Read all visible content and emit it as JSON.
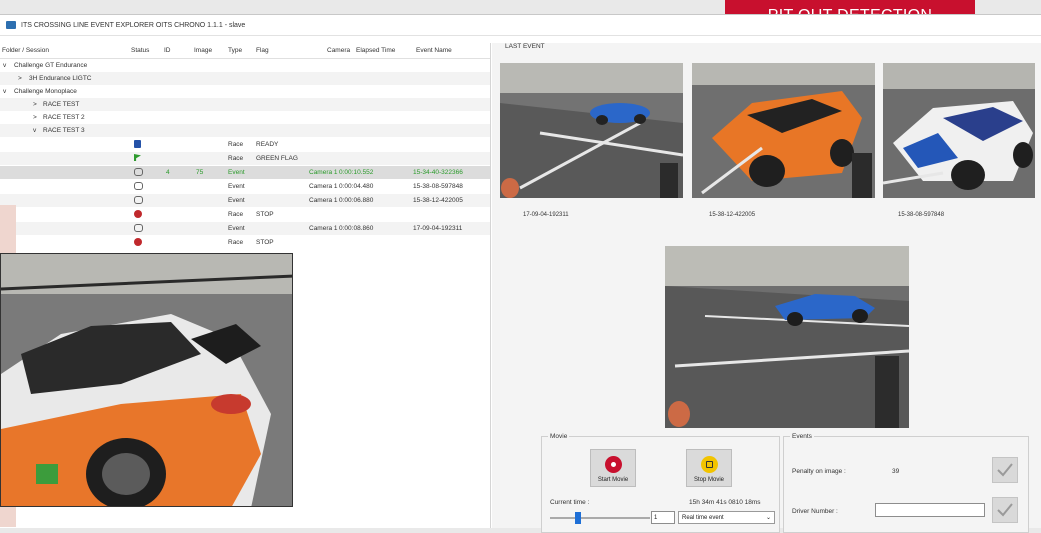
{
  "header": {
    "badge": "PIT OUT DETECTION"
  },
  "window": {
    "title": "ITS CROSSING LINE EVENT EXPLORER OITS CHRONO 1.1.1 - slave"
  },
  "table": {
    "columns": [
      "Folder / Session",
      "Status",
      "ID",
      "Image",
      "Type",
      "Flag",
      "Camera",
      "Elapsed Time",
      "Event Name"
    ],
    "tree": [
      {
        "indent": 0,
        "arrow": "v",
        "label": "Challenge GT Endurance"
      },
      {
        "indent": 1,
        "arrow": ">",
        "label": "3H Endurance LIGTC"
      },
      {
        "indent": 0,
        "arrow": "v",
        "label": "Challenge Monoplace"
      },
      {
        "indent": 1,
        "arrow": ">",
        "label": "RACE TEST"
      },
      {
        "indent": 1,
        "arrow": ">",
        "label": "RACE TEST 2"
      },
      {
        "indent": 1,
        "arrow": "v",
        "label": "RACE TEST 3"
      }
    ],
    "events": [
      {
        "icon": "blue-flag",
        "id": "",
        "image": "",
        "type": "Race",
        "flag": "READY",
        "camera": "",
        "elapsed": "",
        "event": ""
      },
      {
        "icon": "green-flag",
        "id": "",
        "image": "",
        "type": "Race",
        "flag": "GREEN FLAG",
        "camera": "",
        "elapsed": "",
        "event": ""
      },
      {
        "icon": "camera",
        "id": "4",
        "image": "75",
        "type": "Event",
        "flag": "",
        "camera": "Camera 1",
        "elapsed": "0:00:10.552",
        "event": "15-34-40-322366"
      },
      {
        "icon": "camera",
        "id": "",
        "image": "",
        "type": "Event",
        "flag": "",
        "camera": "Camera 1",
        "elapsed": "0:00:04.480",
        "event": "15-38-08-597848"
      },
      {
        "icon": "camera",
        "id": "",
        "image": "",
        "type": "Event",
        "flag": "",
        "camera": "Camera 1",
        "elapsed": "0:00:06.880",
        "event": "15-38-12-422005"
      },
      {
        "icon": "stop",
        "id": "",
        "image": "",
        "type": "Race",
        "flag": "STOP",
        "camera": "",
        "elapsed": "",
        "event": ""
      },
      {
        "icon": "camera",
        "id": "",
        "image": "",
        "type": "Event",
        "flag": "",
        "camera": "Camera 1",
        "elapsed": "0:00:08.860",
        "event": "17-09-04-192311"
      },
      {
        "icon": "stop",
        "id": "",
        "image": "",
        "type": "Race",
        "flag": "STOP",
        "camera": "",
        "elapsed": "",
        "event": ""
      }
    ]
  },
  "last_event": {
    "label": "LAST EVENT",
    "captions": [
      "17-09-04-192311",
      "15-38-12-422005",
      "15-38-08-597848"
    ]
  },
  "movie": {
    "title": "Movie",
    "start_label": "Start Movie",
    "stop_label": "Stop Movie",
    "current_time_label": "Current time :",
    "current_time_value": "15h 34m 41s 0810 18ms",
    "speed_value": "1",
    "mode_value": "Real time event"
  },
  "events_panel": {
    "title": "Events",
    "penalty_label": "Penalty on image :",
    "penalty_value": "39",
    "driver_label": "Driver Number :",
    "driver_value": ""
  },
  "colors": {
    "accent": "#c8102e",
    "green_text": "#2a9a2a"
  }
}
